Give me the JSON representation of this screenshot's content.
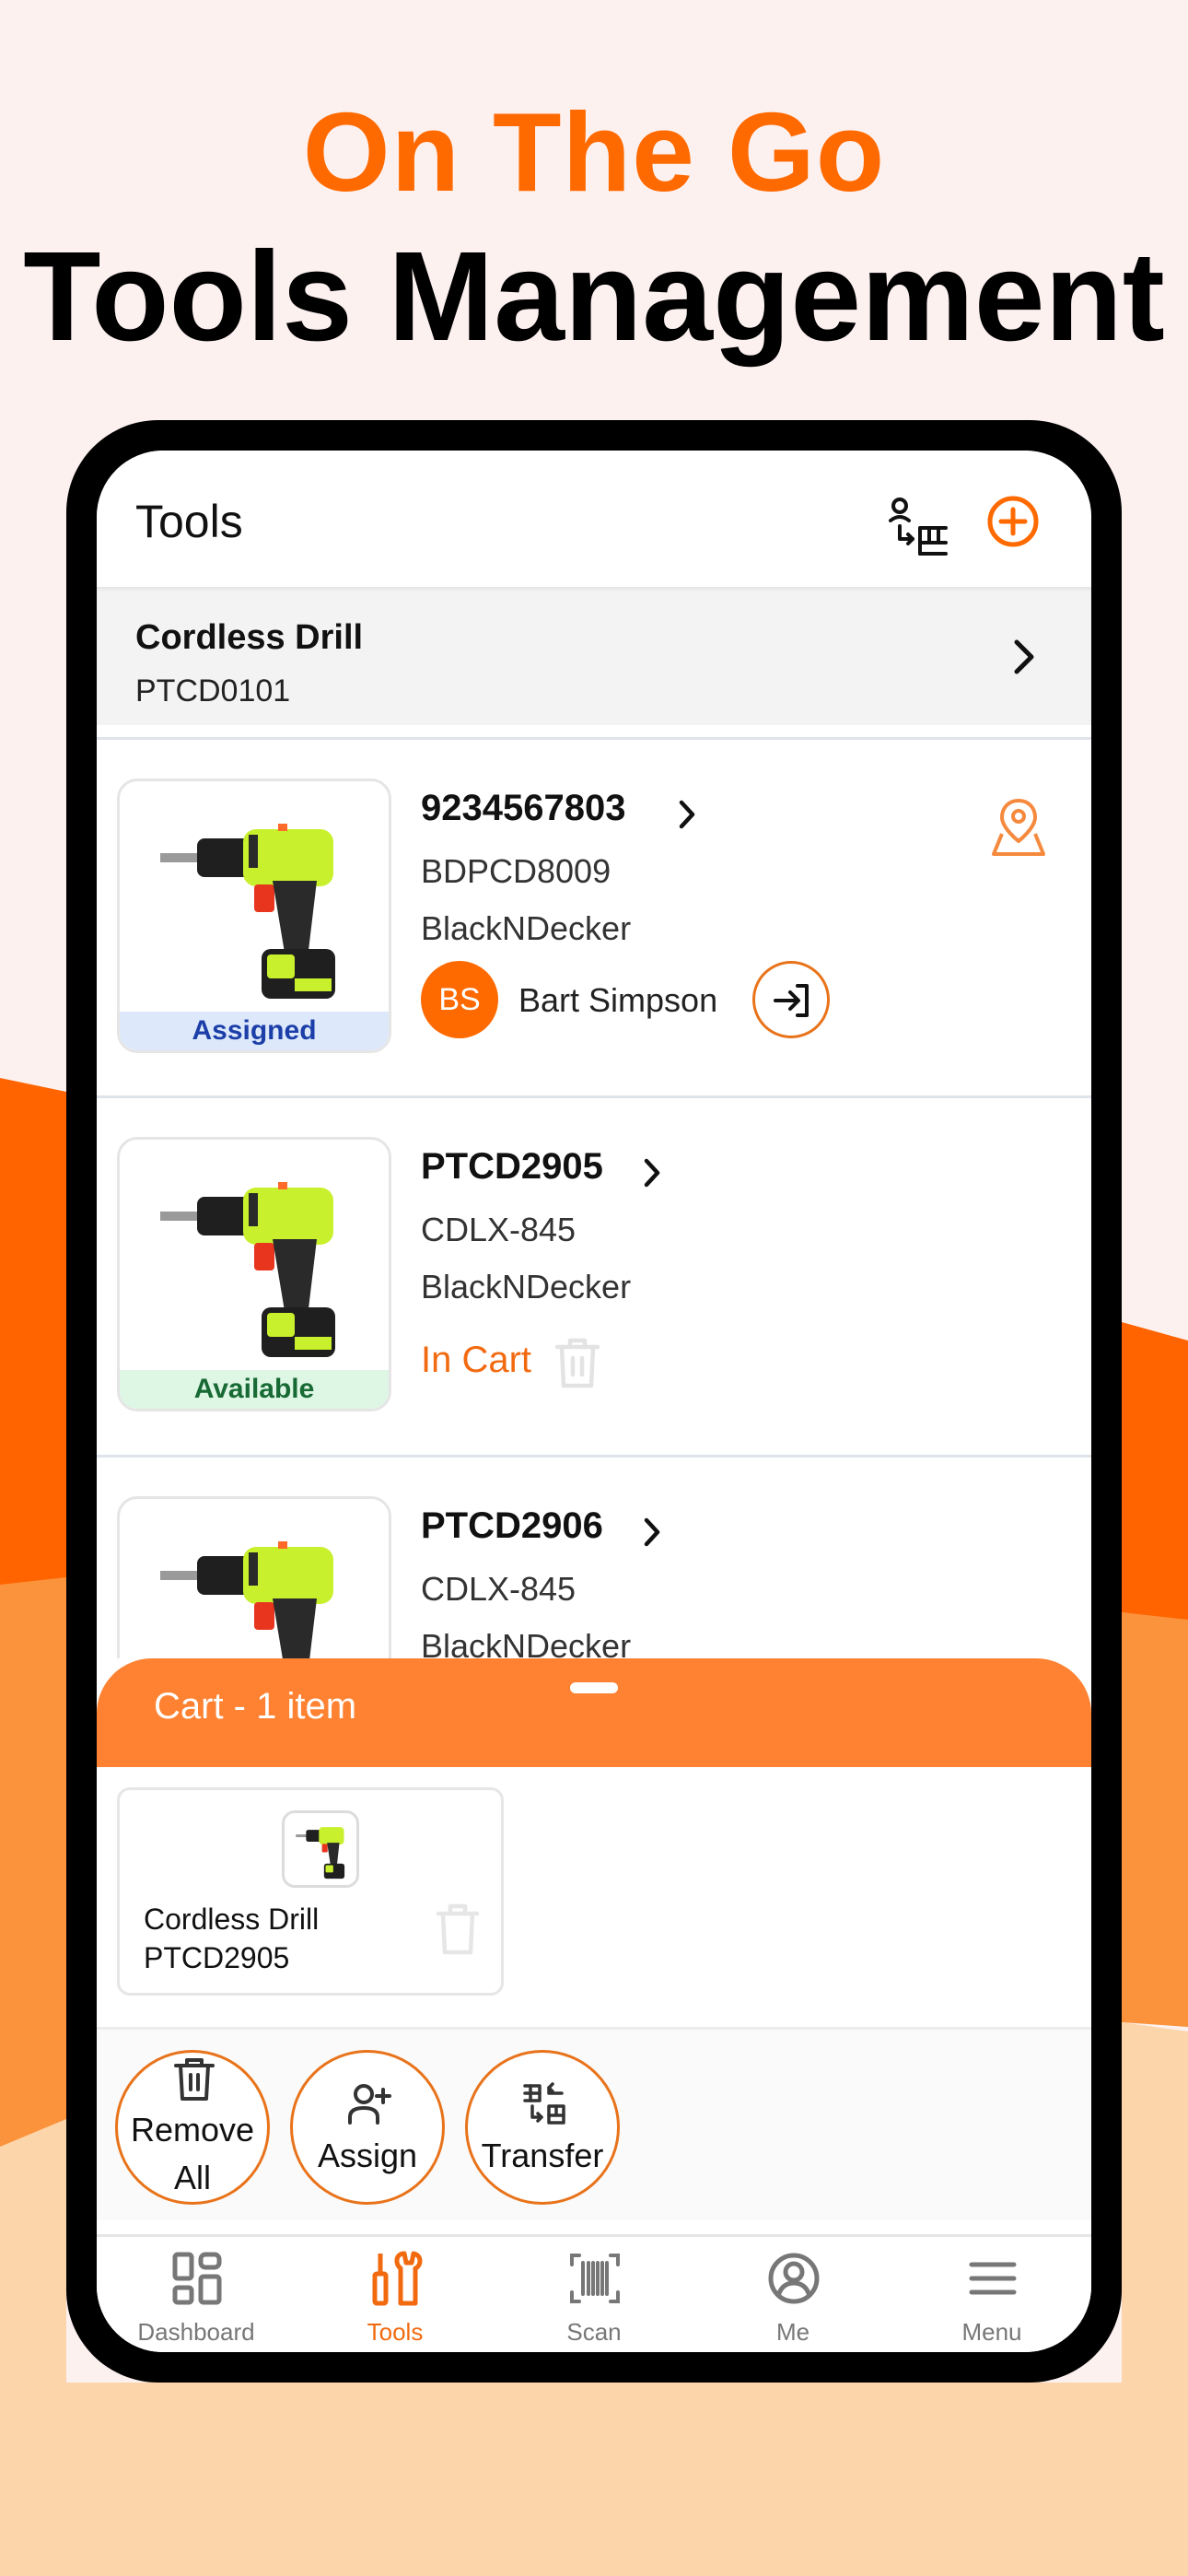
{
  "promo": {
    "headline_line1": "On The Go",
    "headline_line2": "Tools Management"
  },
  "colors": {
    "accent": "#ff6a00",
    "cart_header": "#fe8232",
    "assigned_bg": "#dde9fb",
    "assigned_text": "#1c3ea8",
    "available_bg": "#def6e4",
    "available_text": "#186a34"
  },
  "app": {
    "title": "Tools",
    "header_icons": [
      "transfer-icon",
      "add-circle-icon"
    ]
  },
  "group": {
    "name": "Cordless Drill",
    "code": "PTCD0101"
  },
  "tools": [
    {
      "id": "9234567803",
      "model": "BDPCD8009",
      "brand": "BlackNDecker",
      "status": "Assigned",
      "assignee_initials": "BS",
      "assignee_name": "Bart Simpson"
    },
    {
      "id": "PTCD2905",
      "model": "CDLX-845",
      "brand": "BlackNDecker",
      "status": "Available",
      "cart_state": "In Cart"
    },
    {
      "id": "PTCD2906",
      "model": "CDLX-845",
      "brand": "BlackNDecker",
      "status": ""
    }
  ],
  "cart": {
    "title": "Cart  - 1 item",
    "items": [
      {
        "name": "Cordless Drill",
        "code": "PTCD2905"
      }
    ],
    "actions": [
      {
        "label_line1": "Remove",
        "label_line2": "All",
        "icon": "trash-icon"
      },
      {
        "label_line1": "Assign",
        "icon": "assign-user-icon"
      },
      {
        "label_line1": "Transfer",
        "icon": "transfer-icon"
      }
    ]
  },
  "nav": {
    "items": [
      {
        "label": "Dashboard",
        "icon": "dashboard-icon"
      },
      {
        "label": "Tools",
        "icon": "tools-icon",
        "active": true
      },
      {
        "label": "Scan",
        "icon": "barcode-scan-icon"
      },
      {
        "label": "Me",
        "icon": "profile-icon"
      },
      {
        "label": "Menu",
        "icon": "hamburger-menu-icon"
      }
    ]
  }
}
